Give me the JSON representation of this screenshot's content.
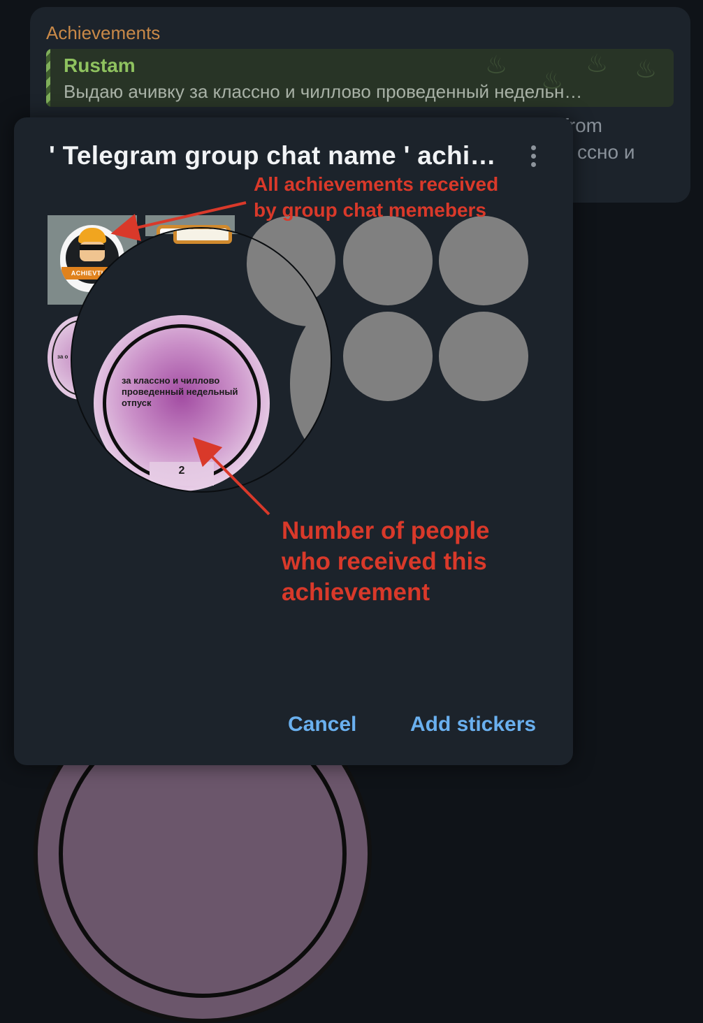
{
  "background": {
    "section_title": "Achievements",
    "reply": {
      "author": "Rustam",
      "text": "Выдаю ачивку за классно и чиллово проведенный недельн…"
    },
    "hidden_line_1_tail": "from",
    "hidden_line_2_tail": "ссно и"
  },
  "dialog": {
    "title": "' Telegram group chat name ' achi…",
    "menu_icon": "more-vertical-icon",
    "stickers": [
      {
        "name": "achievement-sticker",
        "text": "ACHIEVTION"
      },
      {
        "name": "framed-sticker"
      },
      {
        "name": "placeholder"
      },
      {
        "name": "placeholder"
      },
      {
        "name": "placeholder"
      },
      {
        "name": "vacation-sticker"
      },
      {
        "name": "placeholder"
      },
      {
        "name": "placeholder"
      }
    ],
    "magnified_sticker": {
      "text": "за классно и чиллово проведенный недельный отпуск",
      "count": "2"
    },
    "cancel_label": "Cancel",
    "add_label": "Add stickers"
  },
  "annotations": {
    "top_line_1": "All achievements received",
    "top_line_2": "by group chat memebers",
    "bottom_line_1": "Number of people",
    "bottom_line_2": "who received this",
    "bottom_line_3": "achievement"
  },
  "colors": {
    "dialog_bg": "#1c232b",
    "accent": "#6ab0ef",
    "annotation": "#d9392a",
    "author": "#8fc25f",
    "section_title": "#c98948"
  }
}
